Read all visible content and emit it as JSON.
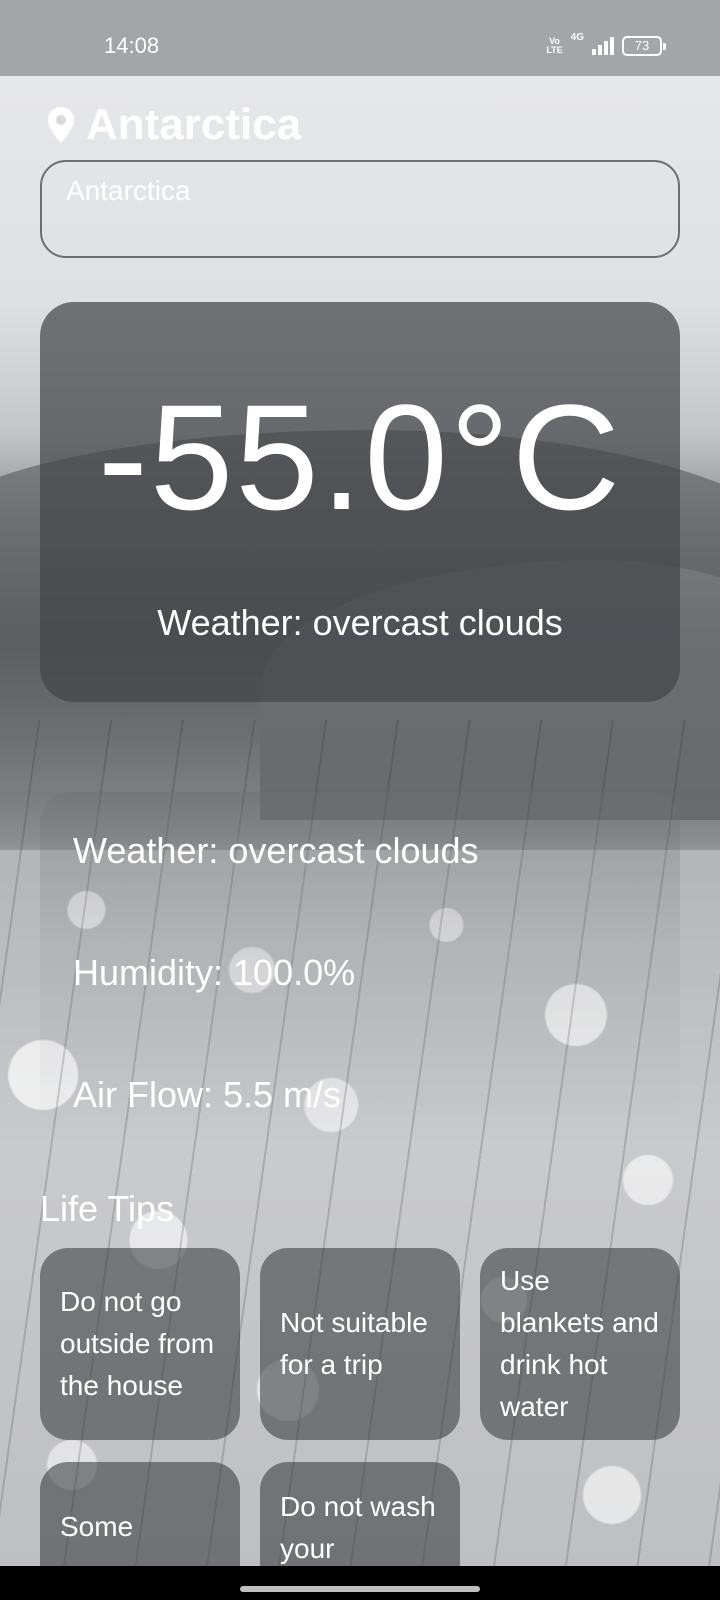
{
  "status_bar": {
    "time": "14:08",
    "volte_top": "Vo",
    "volte_bottom": "LTE",
    "network": "4G",
    "battery": "73"
  },
  "header": {
    "location_icon": "location-pin-icon",
    "location": "Antarctica"
  },
  "search": {
    "placeholder": "Antarctica"
  },
  "current": {
    "temperature": "-55.0°C",
    "description": "Weather: overcast clouds"
  },
  "details": {
    "weather": "Weather: overcast clouds",
    "humidity": "Humidity: 100.0%",
    "air_flow": "Air Flow: 5.5 m/s"
  },
  "tips": {
    "title": "Life Tips",
    "items": [
      "Do not go outside from the house",
      "Not suitable for a trip",
      "Use blankets and drink hot water",
      "Some",
      "Do not wash your"
    ]
  },
  "colors": {
    "status_bar": "#a4a5a9",
    "card_dark": "#44454a",
    "text": "#ffffff"
  }
}
